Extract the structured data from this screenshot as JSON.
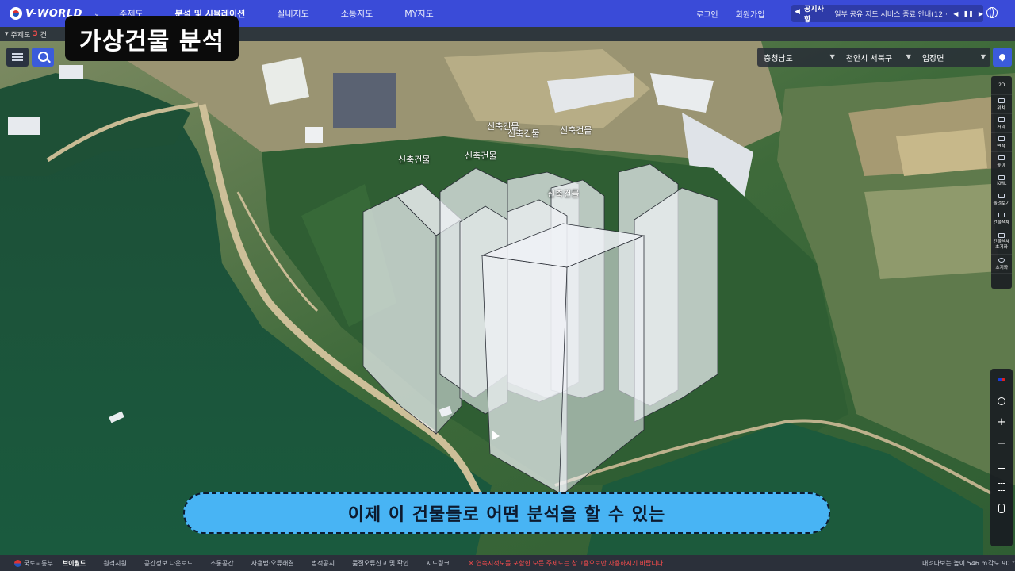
{
  "nav": {
    "brand": "V-WORLD",
    "menu": [
      "주제도",
      "분석 및 시뮬레이션",
      "실내지도",
      "소통지도",
      "MY지도"
    ],
    "active_index": 1,
    "login": "로그인",
    "signup": "회원가입",
    "notice_title": "공지사항",
    "notice_text": "일부 공유 지도 서비스 종료 안내(12···"
  },
  "subbar": {
    "label": "주제도",
    "count": "3",
    "unit": "건"
  },
  "caption_top": "가상건물 분석",
  "region": {
    "province": "충청남도",
    "city": "천안시 서북구",
    "town": "입장면"
  },
  "right_tools": [
    "2D",
    "위치",
    "거리",
    "면적",
    "높이",
    "KML",
    "돌려보기",
    "건물색채",
    "건물색채 초기화",
    "초기화"
  ],
  "building_labels": [
    "신축건물",
    "신축건물",
    "신축건물",
    "신축건물",
    "신축건물",
    "신축건물"
  ],
  "subtitle": "이제 이 건물들로 어떤 분석을 할 수 있는",
  "footer": {
    "ministry": "국토교통부",
    "brand": "브이월드",
    "links": [
      "원격지원",
      "공간정보 다운로드",
      "소통공간",
      "사용법·오류해결",
      "법적공지",
      "품질오류신고 및 확인",
      "지도링크"
    ],
    "warning": "※ 연속지적도를 포함한 모든 주제도는 참고용으로만 사용하시기 바랍니다.",
    "altitude": "내려다보는 높이 546 m",
    "angle": "각도 90 °"
  },
  "colors": {
    "nav_bg": "#3a4bd8",
    "subtitle_bg": "#48b4f4",
    "water": "#1f5a3c",
    "building": "#e8ecf1"
  }
}
